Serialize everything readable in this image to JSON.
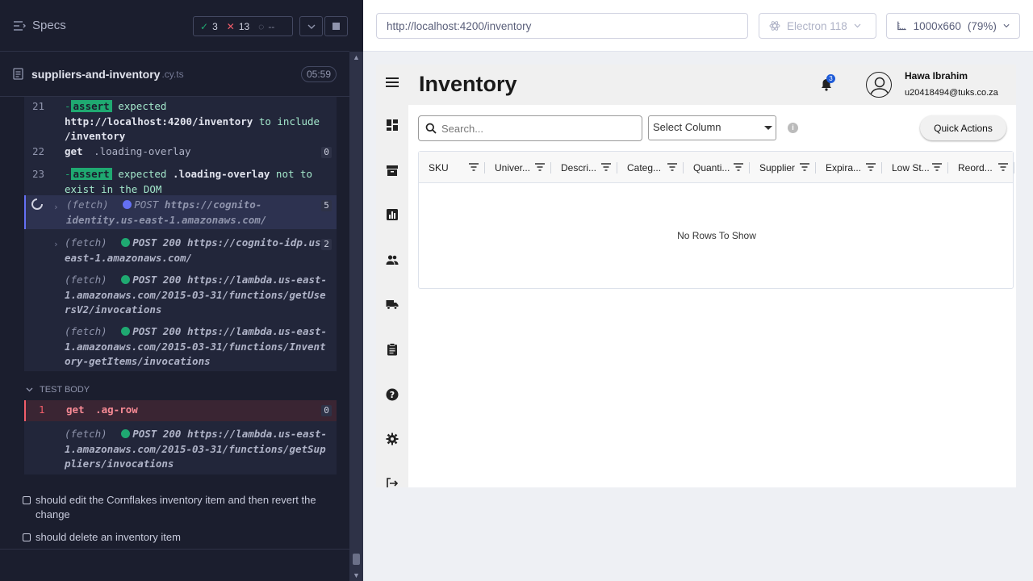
{
  "runner": {
    "specs_label": "Specs",
    "passed": "3",
    "failed": "13",
    "pending": "--",
    "file_name": "suppliers-and-inventory",
    "file_ext": ".cy.ts",
    "duration": "05:59",
    "commands": [
      {
        "num": "21",
        "assert": "assert",
        "text1": "expected",
        "text2": "http://localhost:4200/inventory",
        "text3": "to include",
        "text4": "/inventory"
      },
      {
        "num": "22",
        "name": "get",
        "arg": ".loading-overlay",
        "count": "0"
      },
      {
        "num": "23",
        "assert": "assert",
        "text1": "expected",
        "text2": ".loading-overlay",
        "text3": "not to exist in the DOM"
      },
      {
        "fetch": "(fetch)",
        "method": "POST",
        "url": "https://cognito-identity.us-east-1.amazonaws.com/",
        "count": "5"
      },
      {
        "fetch": "(fetch)",
        "method": "POST 200",
        "url": "https://cognito-idp.us-east-1.amazonaws.com/",
        "count": "2"
      },
      {
        "fetch": "(fetch)",
        "method": "POST 200",
        "url": "https://lambda.us-east-1.amazonaws.com/2015-03-31/functions/getUsersV2/invocations"
      },
      {
        "fetch": "(fetch)",
        "method": "POST 200",
        "url": "https://lambda.us-east-1.amazonaws.com/2015-03-31/functions/Inventory-getItems/invocations"
      }
    ],
    "test_body_label": "TEST BODY",
    "body_commands": [
      {
        "num": "1",
        "name": "get",
        "arg": ".ag-row",
        "count": "0"
      },
      {
        "fetch": "(fetch)",
        "method": "POST 200",
        "url": "https://lambda.us-east-1.amazonaws.com/2015-03-31/functions/getSuppliers/invocations"
      }
    ],
    "tests": [
      "should edit the Cornflakes inventory item and then revert the change",
      "should delete an inventory item"
    ]
  },
  "browser": {
    "url": "http://localhost:4200/inventory",
    "browser_name": "Electron 118",
    "viewport": "1000x660",
    "zoom": "(79%)"
  },
  "app": {
    "title": "Inventory",
    "notification_count": "3",
    "user_name": "Hawa Ibrahim",
    "user_email": "u20418494@tuks.co.za",
    "search_placeholder": "Search...",
    "select_column": "Select Column",
    "quick_actions": "Quick Actions",
    "columns": [
      "SKU",
      "Univer...",
      "Descri...",
      "Categ...",
      "Quanti...",
      "Supplier",
      "Expira...",
      "Low St...",
      "Reord..."
    ],
    "no_rows": "No Rows To Show",
    "nav_icons": [
      "dashboard-icon",
      "inventory-icon",
      "reports-icon",
      "team-icon",
      "suppliers-icon",
      "orders-icon",
      "help-icon",
      "settings-icon",
      "logout-icon"
    ]
  }
}
